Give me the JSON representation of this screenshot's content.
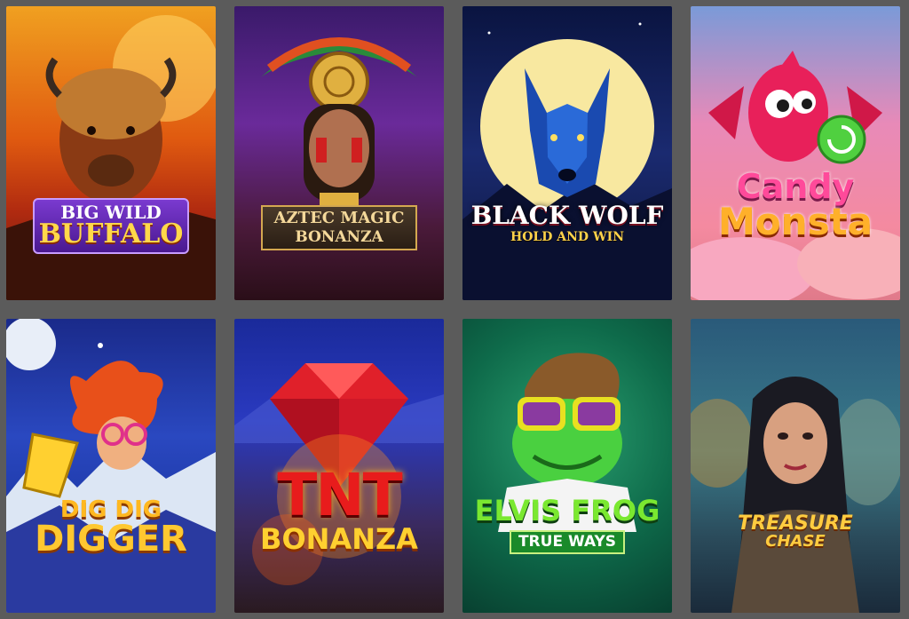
{
  "games": [
    {
      "id": "big-wild-buffalo",
      "line1": "BIG WILD",
      "line2": "BUFFALO"
    },
    {
      "id": "aztec-magic-bonanza",
      "line1": "AZTEC MAGIC",
      "line2": "BONANZA"
    },
    {
      "id": "black-wolf",
      "line1": "BLACK WOLF",
      "line2": "HOLD AND WIN"
    },
    {
      "id": "candy-monsta",
      "line1": "Candy",
      "line2": "Monsta"
    },
    {
      "id": "dig-dig-digger",
      "line1": "DIG DIG",
      "line2": "DIGGER"
    },
    {
      "id": "tnt-bonanza",
      "line1": "TNT",
      "line2": "BONANZA"
    },
    {
      "id": "elvis-frog",
      "line1": "ELVIS FROG",
      "line2": "TRUE WAYS"
    },
    {
      "id": "treasure-chase",
      "line1": "TREASURE",
      "line2": "CHASE"
    }
  ],
  "colors": {
    "page_background": "#5b5b5b",
    "buffalo_sky": "#f0a020",
    "aztec_purple": "#6a2a9a",
    "wolf_night": "#1a2a70",
    "candy_pink": "#f48aa0",
    "digger_blue": "#2a48c0",
    "tnt_red": "#e81c1c",
    "elvis_green": "#0e6a4a",
    "treasure_teal": "#3a7a8a"
  }
}
